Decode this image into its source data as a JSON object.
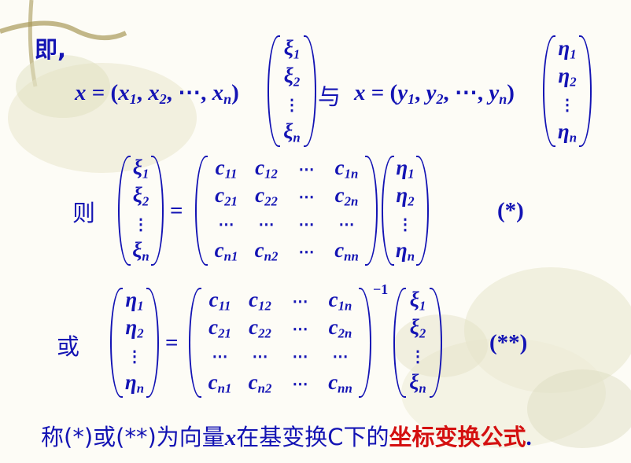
{
  "slide": {
    "lead": "即,",
    "eq1": {
      "lhs": "x = (x",
      "sep": ", ",
      "ellipsis": "⋯",
      "rhs_close": ")"
    },
    "connector": "与",
    "eq2": {
      "lhs": "x = (y"
    },
    "then_label": "则",
    "or_label": "或",
    "xi": "ξ",
    "eta": "η",
    "c": "c",
    "sub1": "1",
    "sub2": "2",
    "subn": "n",
    "sub11": "11",
    "sub12": "12",
    "sub1n": "1n",
    "sub21": "21",
    "sub22": "22",
    "sub2n": "2n",
    "subn1": "n1",
    "subn2": "n2",
    "subnn": "nn",
    "hdots": "⋯",
    "vdots": "⋮",
    "ddots_row": "⋯",
    "inverse_exp": "−1",
    "eq_star_tag": "(*)",
    "eq_dstar_tag": "(**)",
    "equals": "=",
    "conclusion_pre": "称(*)或(**)为向量",
    "conclusion_var": "x",
    "conclusion_mid": "在基变换C下的",
    "conclusion_highlight": "坐标变换公式",
    "conclusion_end": "."
  },
  "colors": {
    "text": "#1414b4",
    "highlight": "#d41010",
    "background": "#fdfcf6"
  }
}
